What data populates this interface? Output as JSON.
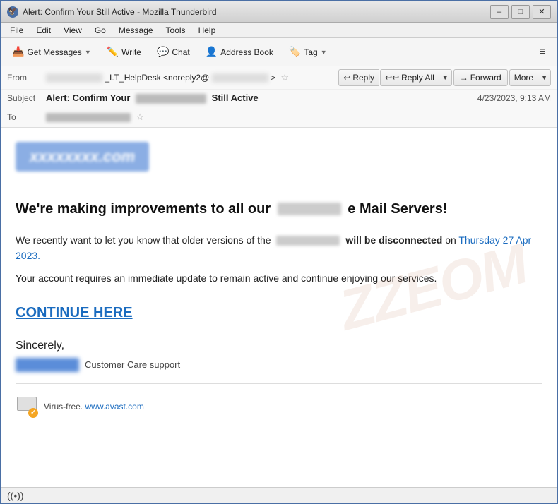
{
  "window": {
    "title": "Alert: Confirm Your          Still Active - Mozilla Thunderbird",
    "icon_label": "TB"
  },
  "titlebar": {
    "minimize_label": "–",
    "maximize_label": "□",
    "close_label": "✕"
  },
  "menubar": {
    "items": [
      "File",
      "Edit",
      "View",
      "Go",
      "Message",
      "Tools",
      "Help"
    ]
  },
  "toolbar": {
    "get_messages_label": "Get Messages",
    "write_label": "Write",
    "chat_label": "Chat",
    "address_book_label": "Address Book",
    "tag_label": "Tag",
    "menu_icon": "≡"
  },
  "email_header": {
    "from_label": "From",
    "from_value": "       _I.T_HelpDesk <noreply2@          >",
    "subject_label": "Subject",
    "subject_prefix": "Alert: Confirm Your",
    "subject_blurred": "                    ",
    "subject_suffix": "Still Active",
    "date": "4/23/2023, 9:13 AM",
    "to_label": "To",
    "to_value": "                   ",
    "reply_label": "Reply",
    "reply_all_label": "Reply All",
    "forward_label": "Forward",
    "more_label": "More"
  },
  "email_body": {
    "logo_text": "xxxxxxxx.com",
    "heading_prefix": "We're making improvements to all our",
    "heading_blurred": "            ",
    "heading_suffix": "e Mail Servers!",
    "body_paragraph1_prefix": "We recently want to let you know that older versions of the",
    "body_paragraph1_blurred": "             ",
    "body_paragraph1_suffix": "will be",
    "body_paragraph1_bold": "disconnected",
    "body_paragraph1_date": "Thursday 27 Apr 2023.",
    "body_paragraph2": "Your account requires an immediate update to remain active and continue enjoying our services.",
    "continue_link": "CONTINUE HERE",
    "sincerely": "Sincerely,",
    "sender_title": "Customer Care support",
    "virus_text": "Virus-free.",
    "avast_link": "www.avast.com",
    "watermark": "ZZEOM"
  },
  "statusbar": {
    "wifi_icon": "((•))"
  }
}
